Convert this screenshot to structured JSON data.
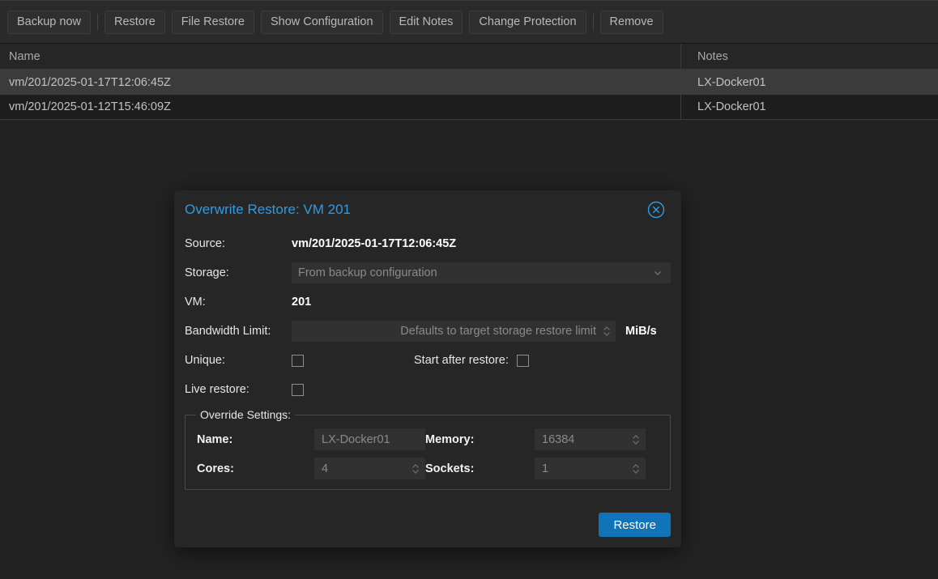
{
  "toolbar": {
    "buttons": [
      {
        "label": "Backup now",
        "sep_after": true
      },
      {
        "label": "Restore",
        "sep_after": false
      },
      {
        "label": "File Restore",
        "sep_after": false
      },
      {
        "label": "Show Configuration",
        "sep_after": false
      },
      {
        "label": "Edit Notes",
        "sep_after": false
      },
      {
        "label": "Change Protection",
        "sep_after": true
      },
      {
        "label": "Remove",
        "sep_after": false
      }
    ]
  },
  "table": {
    "columns": [
      "Name",
      "Notes"
    ],
    "rows": [
      {
        "name": "vm/201/2025-01-17T12:06:45Z",
        "notes": "LX-Docker01",
        "selected": true
      },
      {
        "name": "vm/201/2025-01-12T15:46:09Z",
        "notes": "LX-Docker01",
        "selected": false
      }
    ]
  },
  "dialog": {
    "title": "Overwrite Restore: VM 201",
    "close_icon": "circle-x-icon",
    "accent_color": "#2e9be8",
    "fields": {
      "source_label": "Source:",
      "source_value": "vm/201/2025-01-17T12:06:45Z",
      "storage_label": "Storage:",
      "storage_placeholder": "From backup configuration",
      "storage_value": "",
      "vm_label": "VM:",
      "vm_value": "201",
      "bandwidth_label": "Bandwidth Limit:",
      "bandwidth_placeholder": "Defaults to target storage restore limit",
      "bandwidth_value": "",
      "bandwidth_unit": "MiB/s",
      "unique_label": "Unique:",
      "unique_checked": false,
      "start_after_restore_label": "Start after restore:",
      "start_after_restore_checked": false,
      "live_restore_label": "Live restore:",
      "live_restore_checked": false
    },
    "override": {
      "legend": "Override Settings:",
      "name_label": "Name:",
      "name_placeholder": "LX-Docker01",
      "name_value": "",
      "memory_label": "Memory:",
      "memory_placeholder": "16384",
      "memory_value": "",
      "cores_label": "Cores:",
      "cores_placeholder": "4",
      "cores_value": "",
      "sockets_label": "Sockets:",
      "sockets_placeholder": "1",
      "sockets_value": ""
    },
    "submit_label": "Restore",
    "submit_color": "#1173b8"
  }
}
